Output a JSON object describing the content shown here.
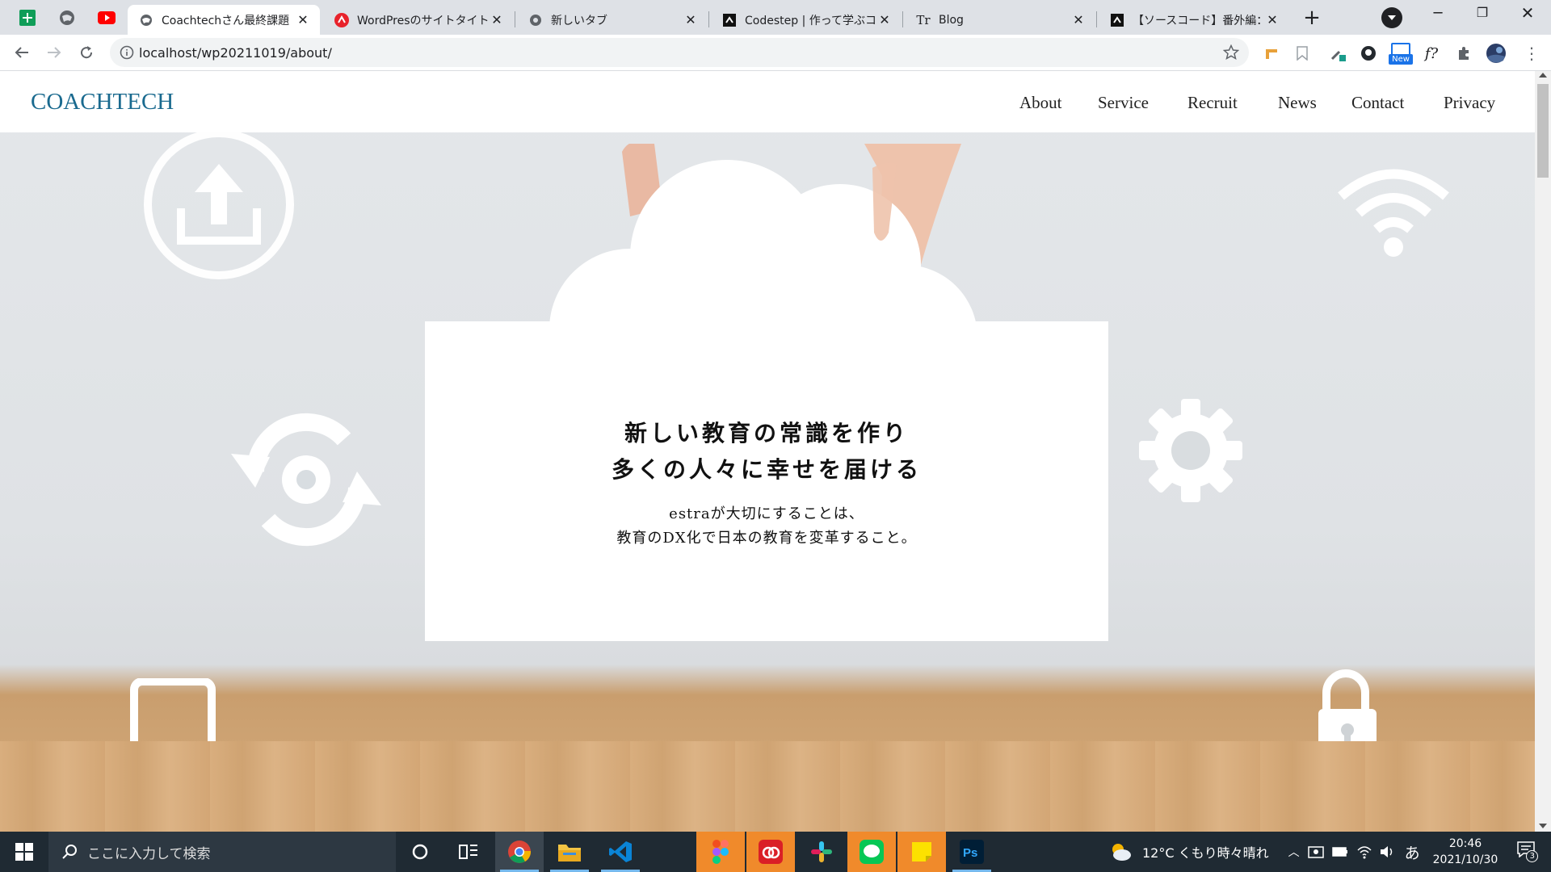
{
  "browser": {
    "tabs": [
      {
        "title": "Coachtechさん最終課題",
        "active": true
      },
      {
        "title": "WordPresのサイトタイトル・",
        "active": false
      },
      {
        "title": "新しいタブ",
        "active": false
      },
      {
        "title": "Codestep | 作って学ぶコー",
        "active": false
      },
      {
        "title": "Blog",
        "active": false
      },
      {
        "title": "【ソースコード】番外編：アニ",
        "active": false
      }
    ],
    "url": "localhost/wp20211019/about/",
    "new_tab_symbol": "+",
    "ext_new_badge": "New",
    "ext_f_label": "f?"
  },
  "site": {
    "logo": "COACHTECH",
    "nav": [
      "About",
      "Service",
      "Recruit",
      "News",
      "Contact",
      "Privacy"
    ],
    "headline_line1": "新しい教育の常識を作り",
    "headline_line2": "多くの人々に幸せを届ける",
    "sub_line1": "estraが大切にすることは、",
    "sub_line2": "教育のDX化で日本の教育を変革すること。"
  },
  "taskbar": {
    "search_placeholder": "ここに入力して検索",
    "weather": "12°C  くもり時々晴れ",
    "ime": "あ",
    "time": "20:46",
    "date": "2021/10/30",
    "notification_count": "3"
  },
  "colors": {
    "logo": "#1a6a8f",
    "tabbar": "#dee1e6",
    "taskbar": "#1f2a33",
    "accent_blue": "#1a73e8"
  }
}
